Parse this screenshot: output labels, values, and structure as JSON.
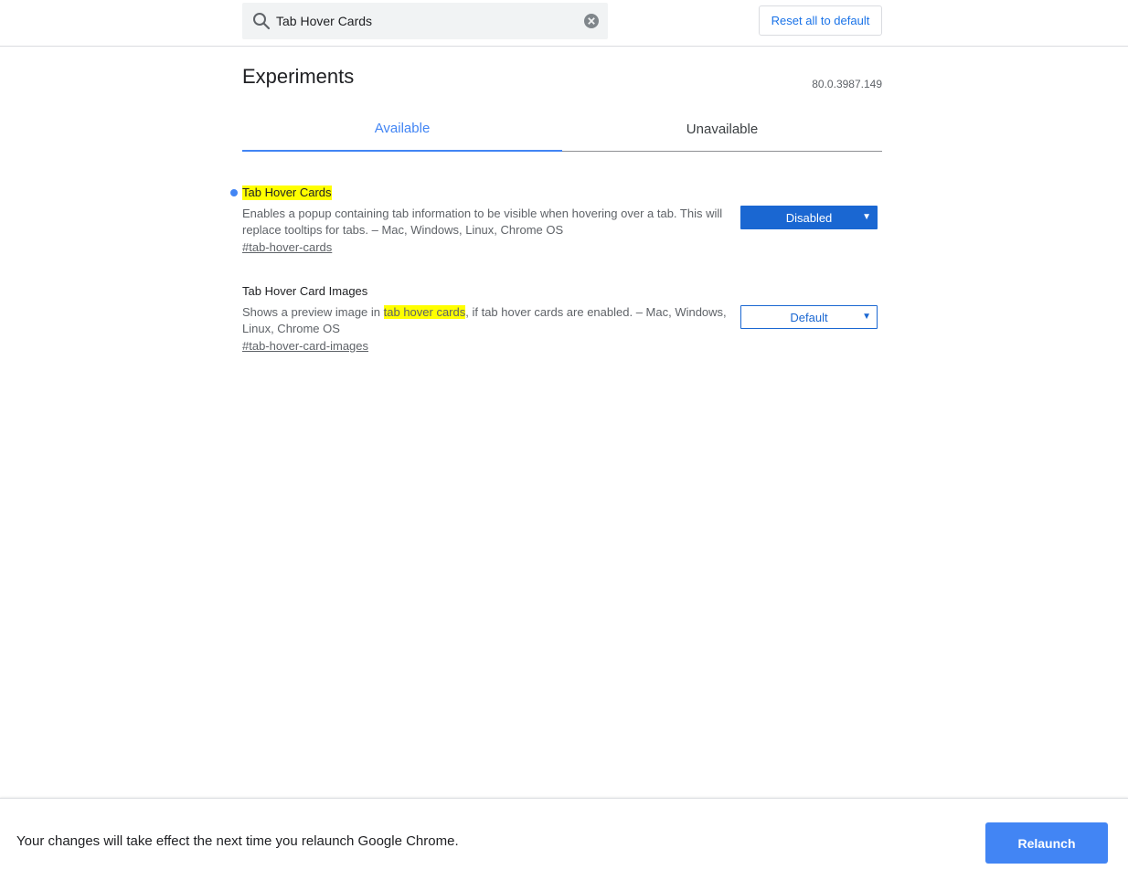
{
  "search": {
    "value": "Tab Hover Cards",
    "icon": "search-icon",
    "clear_icon": "clear-icon"
  },
  "header": {
    "reset_label": "Reset all to default"
  },
  "page": {
    "title": "Experiments",
    "version": "80.0.3987.149"
  },
  "tabs": [
    {
      "label": "Available",
      "active": true
    },
    {
      "label": "Unavailable",
      "active": false
    }
  ],
  "experiments": [
    {
      "title": "Tab Hover Cards",
      "description": "Enables a popup containing tab information to be visible when hovering over a tab. This will replace tooltips for tabs. – Mac, Windows, Linux, Chrome OS",
      "link": "#tab-hover-cards",
      "value": "Disabled",
      "modified": true
    },
    {
      "title": "Tab Hover Card Images",
      "description_before": "Shows a preview image in ",
      "description_highlight": "tab hover cards",
      "description_after": ", if tab hover cards are enabled. – Mac, Windows, Linux, Chrome OS",
      "link": "#tab-hover-card-images",
      "value": "Default",
      "modified": false
    }
  ],
  "footer": {
    "message": "Your changes will take effect the next time you relaunch Google Chrome.",
    "relaunch_label": "Relaunch"
  },
  "colors": {
    "accent": "#4285f4",
    "select_blue": "#1a67d2",
    "highlight": "#ffff00"
  }
}
